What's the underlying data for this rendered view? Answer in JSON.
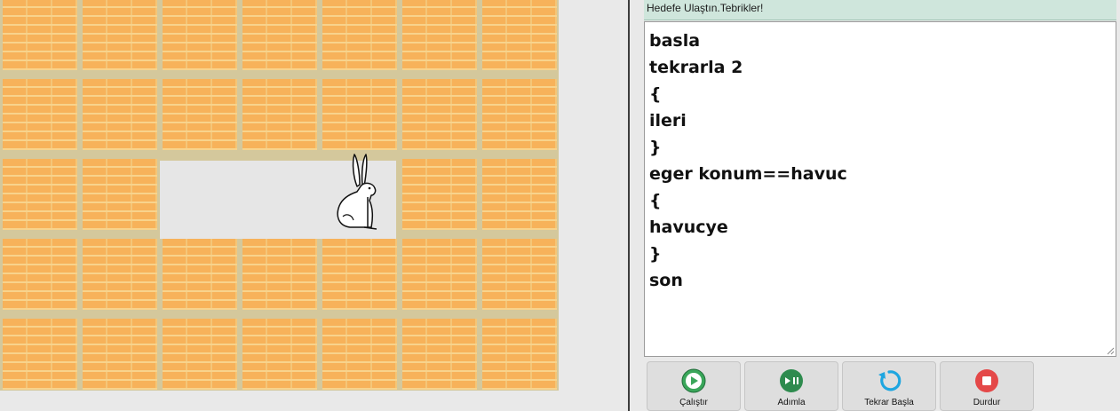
{
  "status": {
    "message": "Hedefe Ulaştın.Tebrikler!"
  },
  "editor": {
    "code": "basla\ntekrarla 2\n{\nileri\n}\neger konum==havuc\n{\nhavucye\n}\nson"
  },
  "controls": {
    "run": {
      "label": "Çalıştır",
      "icon": "play-icon",
      "color": "#3aa65a"
    },
    "step": {
      "label": "Adımla",
      "icon": "step-play-pause-icon",
      "color": "#2e8b4e"
    },
    "restart": {
      "label": "Tekrar Başla",
      "icon": "restart-icon",
      "color": "#1ea6e0"
    },
    "stop": {
      "label": "Durdur",
      "icon": "stop-icon",
      "color": "#e44848"
    }
  },
  "board": {
    "columns": 7,
    "rows": 5,
    "path_cells": [
      [
        2,
        2
      ],
      [
        3,
        2
      ],
      [
        4,
        2
      ]
    ],
    "character": {
      "icon": "rabbit-icon",
      "cell": [
        4,
        2
      ]
    },
    "colors": {
      "wall": "#f7b25a",
      "path": "#e6e6e6",
      "grout": "#d4c89c"
    }
  }
}
